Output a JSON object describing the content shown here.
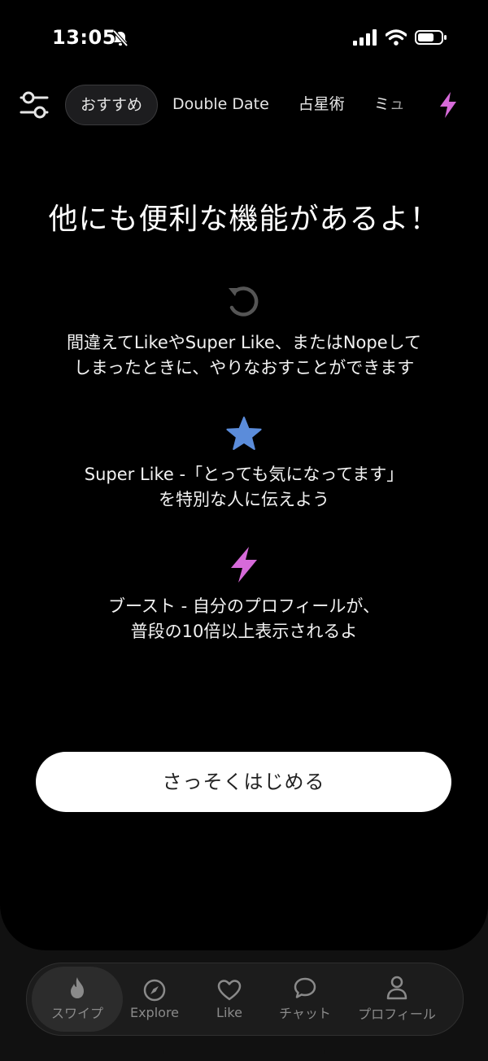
{
  "status_bar": {
    "time": "13:05"
  },
  "top_nav": {
    "tabs": [
      {
        "label": "おすすめ",
        "active": true
      },
      {
        "label": "Double Date",
        "active": false
      },
      {
        "label": "占星術",
        "active": false
      },
      {
        "label": "ミュ",
        "active": false
      }
    ]
  },
  "main": {
    "headline": "他にも便利な機能があるよ！",
    "features": [
      {
        "icon": "rewind-icon",
        "line1": "間違えてLikeやSuper Like、またはNopeして",
        "line2": "しまったときに、やりなおすことができます"
      },
      {
        "icon": "star-icon",
        "line1": "Super Like -「とっても気になってます」",
        "line2": "を特別な人に伝えよう"
      },
      {
        "icon": "bolt-icon",
        "line1": "ブースト - 自分のプロフィールが、",
        "line2": "普段の10倍以上表示されるよ"
      }
    ],
    "cta_label": "さっそくはじめる"
  },
  "bottom_nav": {
    "items": [
      {
        "label": "スワイプ",
        "icon": "flame-icon",
        "active": true
      },
      {
        "label": "Explore",
        "icon": "compass-icon",
        "active": false
      },
      {
        "label": "Like",
        "icon": "heart-icon",
        "active": false
      },
      {
        "label": "チャット",
        "icon": "chat-icon",
        "active": false
      },
      {
        "label": "プロフィール",
        "icon": "person-icon",
        "active": false
      }
    ]
  },
  "colors": {
    "star": "#5b8cda",
    "bolt": "#d66ad9",
    "background": "#000000"
  }
}
